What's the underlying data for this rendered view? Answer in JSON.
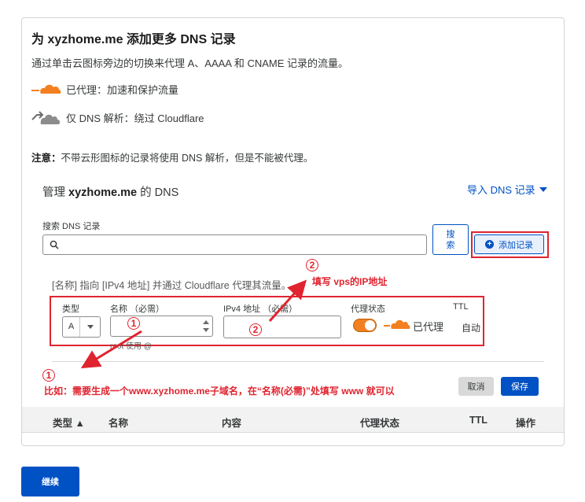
{
  "card": {
    "title": "为 xyzhome.me 添加更多 DNS 记录",
    "description": "通过单击云图标旁边的切换来代理 A、AAAA 和 CNAME 记录的流量。",
    "legend": [
      {
        "label": "已代理：加速和保护流量",
        "icon": "cloud-proxied-icon"
      },
      {
        "label": "仅 DNS 解析：绕过 Cloudflare",
        "icon": "cloud-dns-only-icon"
      }
    ],
    "note_bold": "注意：",
    "note_text": "不带云形图标的记录将使用 DNS 解析，但是不能被代理。"
  },
  "manage": {
    "prefix": "管理 ",
    "domain": "xyzhome.me",
    "suffix": " 的 DNS",
    "import_label": "导入 DNS 记录"
  },
  "search": {
    "label": "搜索 DNS 记录",
    "placeholder": "",
    "button_line1": "搜",
    "button_line2": "索",
    "add_label": "添加记录"
  },
  "form": {
    "hint": "[名称] 指向 [IPv4 地址] 并通过 Cloudflare 代理其流量。",
    "type_label": "类型",
    "type_value": "A",
    "name_label": "名称 （必需）",
    "ip_label": "IPv4 地址 （必需）",
    "proxy_label": "代理状态",
    "ttl_label": "TTL",
    "proxy_value": "已代理",
    "ttl_value": "自动",
    "root_hint": "root 使用 @",
    "cancel_label": "取消",
    "save_label": "保存"
  },
  "table": {
    "headers": [
      "类型 ▲",
      "名称",
      "内容",
      "代理状态",
      "TTL",
      "操作"
    ]
  },
  "continue_label": "继续",
  "annotations": {
    "num1": "1",
    "num2": "2",
    "note1": "比如：需要生成一个www.xyzhome.me子域名，在“名称(必需)”处填写 www 就可以",
    "note2": "填写 vps的IP地址"
  },
  "colors": {
    "accent": "#0051c3",
    "proxy_orange": "#f38020",
    "annotation_red": "#e0242f"
  }
}
